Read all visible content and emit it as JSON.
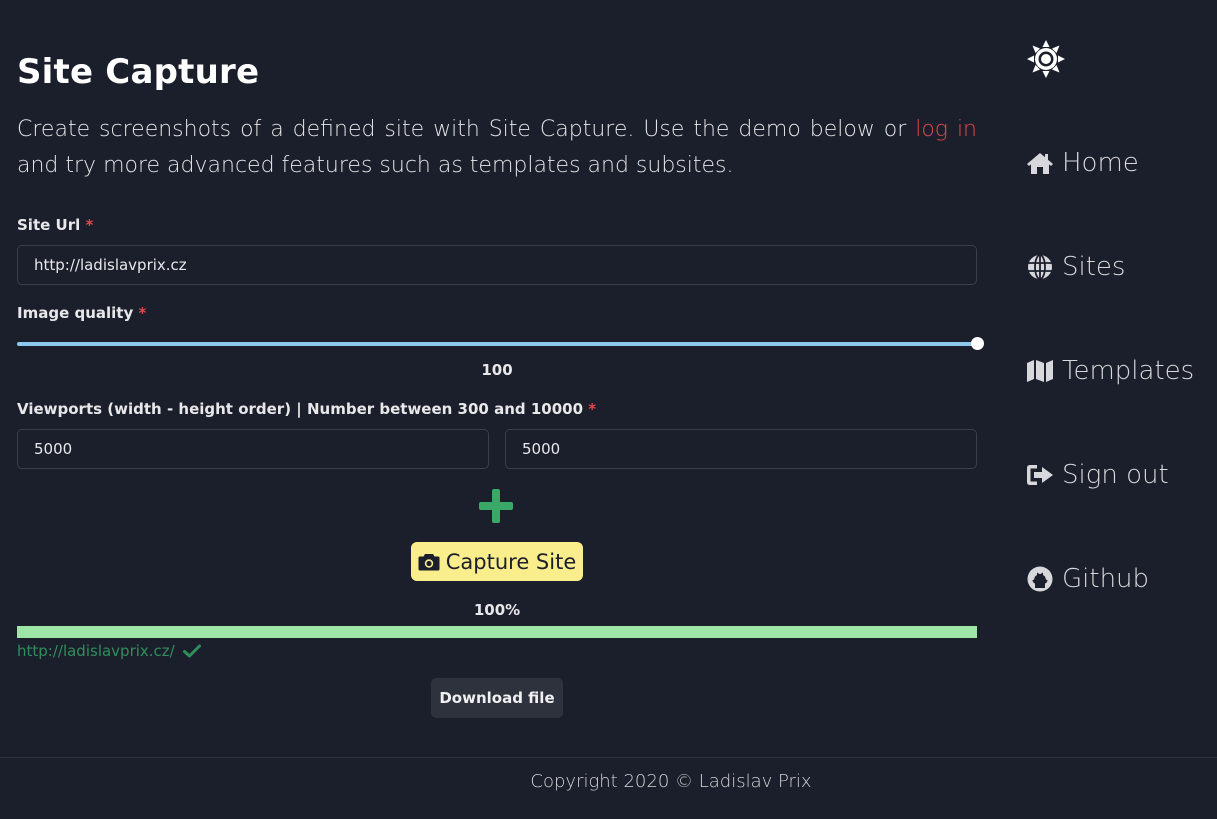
{
  "page": {
    "title": "Site Capture",
    "intro_before": "Create screenshots of a defined site with Site Capture. Use the demo below or ",
    "intro_link": "log in",
    "intro_after": " and try more advanced features such as templates and subsites."
  },
  "form": {
    "site_url_label": "Site Url",
    "site_url_value": "http://ladislavprix.cz",
    "required_mark": "*",
    "image_quality_label": "Image quality",
    "image_quality_value": "100",
    "image_quality_fraction": 1.0,
    "viewports_label": "Viewports (width - height order) | Number between 300 and 10000",
    "viewport_width": "5000",
    "viewport_height": "5000",
    "capture_button_label": "Capture Site"
  },
  "progress": {
    "percent_label": "100%",
    "fraction": 1.0,
    "result_url": "http://ladislavprix.cz/",
    "download_label": "Download file"
  },
  "sidebar": {
    "items": [
      {
        "label": "Home",
        "icon": "home-icon"
      },
      {
        "label": "Sites",
        "icon": "globe-icon"
      },
      {
        "label": "Templates",
        "icon": "map-icon"
      },
      {
        "label": "Sign out",
        "icon": "sign-out-icon"
      },
      {
        "label": "Github",
        "icon": "github-icon"
      }
    ]
  },
  "footer": {
    "copyright": "Copyright 2020 © Ladislav Prix"
  },
  "colors": {
    "background": "#1b1f2b",
    "accent_red": "#e0474c",
    "capture_button": "#f9ed8c",
    "progress": "#9de6a8",
    "success_green": "#2f8f5b",
    "slider": "#8ec9ee"
  }
}
